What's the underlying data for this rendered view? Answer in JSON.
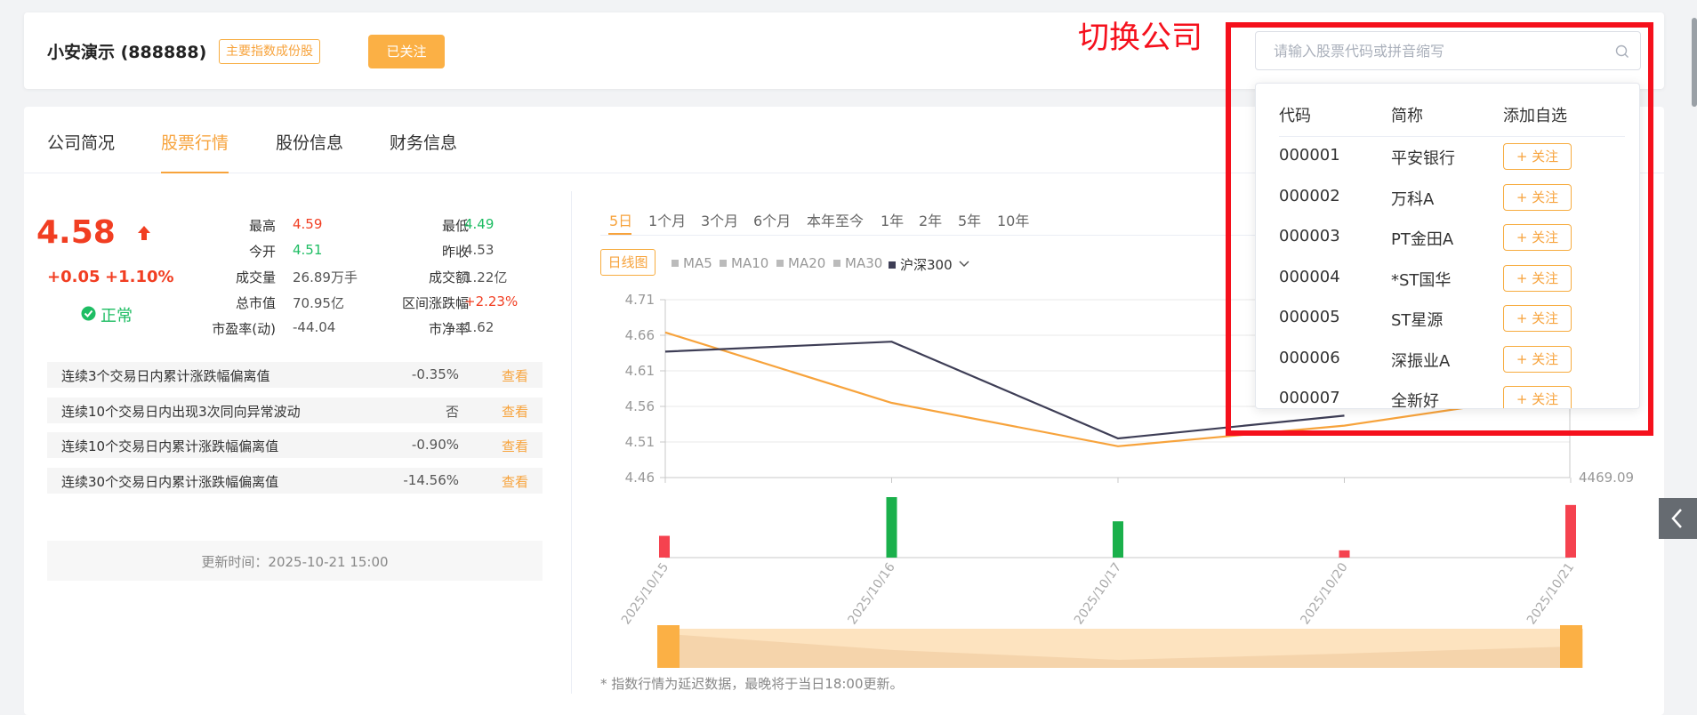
{
  "header": {
    "company_name": "小安演示 (888888)",
    "index_tag": "主要指数成份股",
    "follow_label": "已关注",
    "switch_label": "切换公司",
    "search_placeholder": "请输入股票代码或拼音缩写"
  },
  "tabs": [
    {
      "label": "公司简况",
      "active": false
    },
    {
      "label": "股票行情",
      "active": true
    },
    {
      "label": "股份信息",
      "active": false
    },
    {
      "label": "财务信息",
      "active": false
    }
  ],
  "quote": {
    "price": "4.58",
    "change": "+0.05",
    "change_pct": "+1.10%",
    "status": "正常",
    "stats": [
      {
        "label": "最高",
        "value": "4.59",
        "color": "#f13e22"
      },
      {
        "label": "最低",
        "value": "4.49",
        "color": "#1ebd63"
      },
      {
        "label": "今开",
        "value": "4.51",
        "color": "#1ebd63"
      },
      {
        "label": "昨收",
        "value": "4.53",
        "color": "#555555"
      },
      {
        "label": "成交量",
        "value": "26.89万手",
        "color": "#555555"
      },
      {
        "label": "成交额",
        "value": "1.22亿",
        "color": "#555555"
      },
      {
        "label": "总市值",
        "value": "70.95亿",
        "color": "#555555"
      },
      {
        "label": "区间涨跌幅",
        "value": "+2.23%",
        "color": "#f13e22"
      },
      {
        "label": "市盈率(动)",
        "value": "-44.04",
        "color": "#555555"
      },
      {
        "label": "市净率",
        "value": "1.62",
        "color": "#555555"
      }
    ]
  },
  "risk_rows": [
    {
      "text": "连续3个交易日内累计涨跌幅偏离值",
      "value": "-0.35%",
      "action": "查看"
    },
    {
      "text": "连续10个交易日内出现3次同向异常波动",
      "value": "否",
      "action": "查看"
    },
    {
      "text": "连续10个交易日内累计涨跌幅偏离值",
      "value": "-0.90%",
      "action": "查看"
    },
    {
      "text": "连续30个交易日内累计涨跌幅偏离值",
      "value": "-14.56%",
      "action": "查看"
    }
  ],
  "update_time": "更新时间：2025-10-21 15:00",
  "periods": [
    "5日",
    "1个月",
    "3个月",
    "6个月",
    "本年至今",
    "1年",
    "2年",
    "5年",
    "10年"
  ],
  "active_period": "5日",
  "daily_btn": "日线图",
  "legends": [
    {
      "label": "MA5",
      "active": false
    },
    {
      "label": "MA10",
      "active": false
    },
    {
      "label": "MA20",
      "active": false
    },
    {
      "label": "MA30",
      "active": false
    },
    {
      "label": "沪深300",
      "active": true
    }
  ],
  "note": "* 指数行情为延迟数据，最晚将于当日18:00更新。",
  "chart_data": {
    "type": "line",
    "x": [
      "2025/10/15",
      "2025/10/16",
      "2025/10/17",
      "2025/10/20",
      "2025/10/21"
    ],
    "y_ticks": [
      "4.71",
      "4.66",
      "4.61",
      "4.56",
      "4.51",
      "4.46"
    ],
    "ylim": [
      4.46,
      4.71
    ],
    "right_axis_label": "4469.09",
    "series": [
      {
        "name": "",
        "color": "#f7a33c",
        "values": [
          4.664,
          4.565,
          4.504,
          4.533,
          4.58
        ]
      },
      {
        "name": "沪深300",
        "color": "#3e3e56",
        "values": [
          4.637,
          4.651,
          4.515,
          4.547,
          null
        ]
      }
    ],
    "volume": [
      {
        "direction": "up",
        "value": 0.36
      },
      {
        "direction": "down",
        "value": 1.0
      },
      {
        "direction": "down",
        "value": 0.6
      },
      {
        "direction": "up",
        "value": 0.12
      },
      {
        "direction": "up",
        "value": 0.87
      }
    ],
    "up_color": "#f5424f",
    "down_color": "#1ab04b"
  },
  "dropdown": {
    "headers": [
      "代码",
      "简称",
      "添加自选"
    ],
    "follow_label": "+ 关注",
    "rows": [
      {
        "code": "000001",
        "name": "平安银行"
      },
      {
        "code": "000002",
        "name": "万科A"
      },
      {
        "code": "000003",
        "name": "PT金田A"
      },
      {
        "code": "000004",
        "name": "*ST国华"
      },
      {
        "code": "000005",
        "name": "ST星源"
      },
      {
        "code": "000006",
        "name": "深振业A"
      },
      {
        "code": "000007",
        "name": "全新好"
      }
    ]
  }
}
